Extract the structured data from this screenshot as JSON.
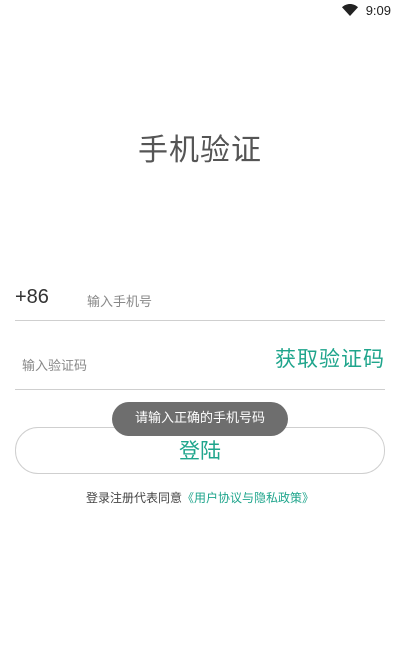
{
  "status_bar": {
    "time": "9:09",
    "wifi_icon": "wifi-icon"
  },
  "page": {
    "title": "手机验证"
  },
  "phone": {
    "country_code": "+86",
    "placeholder": "输入手机号",
    "value": ""
  },
  "code": {
    "placeholder": "输入验证码",
    "value": "",
    "get_code_label": "获取验证码"
  },
  "toast": {
    "message": "请输入正确的手机号码"
  },
  "login": {
    "label": "登陆"
  },
  "agreement": {
    "prefix": "登录注册代表同意",
    "link_text": "《用户协议与隐私政策》"
  },
  "colors": {
    "accent": "#1fa58c",
    "toast_bg": "#6e6e6e",
    "divider": "#cfcfcf",
    "title": "#555555"
  }
}
